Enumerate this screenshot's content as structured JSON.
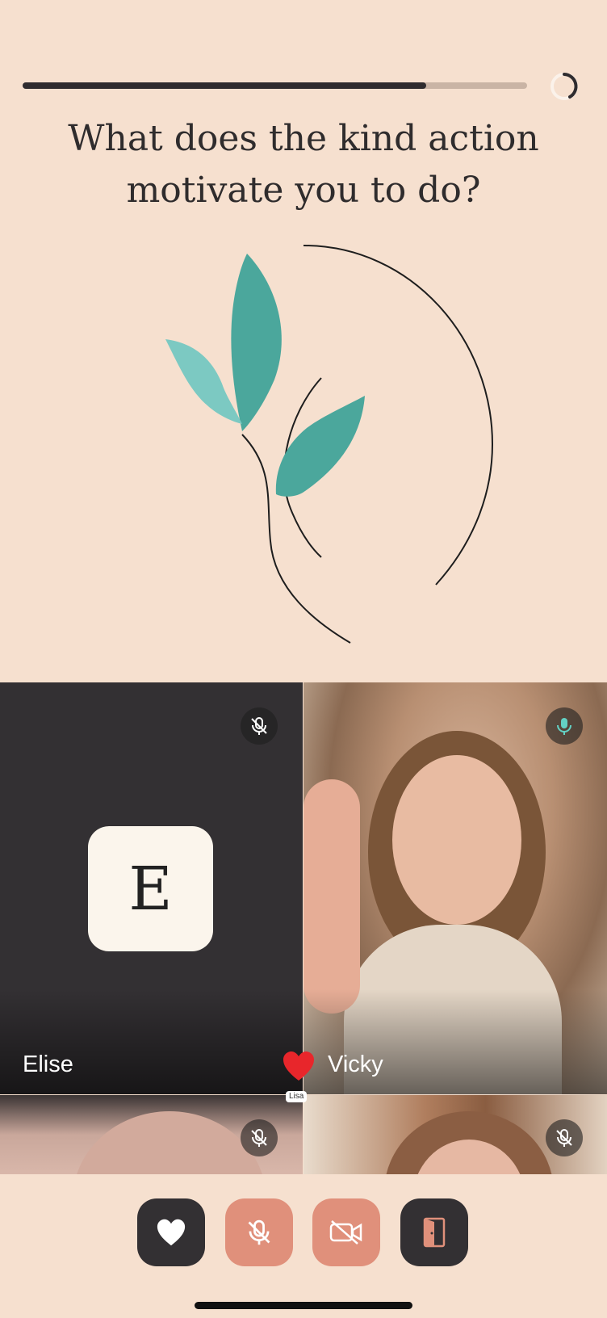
{
  "progress": {
    "fraction": 0.8
  },
  "question": {
    "line1": "What does the kind action",
    "line2": "motivate you to do?"
  },
  "participants": {
    "elise": {
      "name": "Elise",
      "initial": "E",
      "mic": "muted"
    },
    "vicky": {
      "name": "Vicky",
      "mic": "active"
    },
    "bottom_left": {
      "mic": "muted"
    },
    "bottom_right": {
      "mic": "muted"
    }
  },
  "reaction": {
    "icon": "heart-icon",
    "from": "Lisa",
    "color": "#e8262b"
  },
  "controls": [
    {
      "name": "react-button",
      "icon": "heart-icon"
    },
    {
      "name": "mute-button",
      "icon": "mic-off-icon"
    },
    {
      "name": "camera-button",
      "icon": "video-off-icon"
    },
    {
      "name": "leave-button",
      "icon": "door-exit-icon"
    }
  ],
  "colors": {
    "background": "#f6e0cf",
    "leaf_teal": "#4ba79c",
    "leaf_light": "#7cc9c2",
    "dark_tile": "#333033",
    "salmon": "#e0907b"
  }
}
